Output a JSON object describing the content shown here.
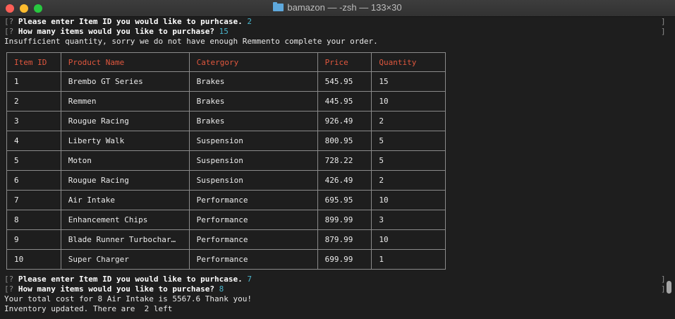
{
  "window": {
    "title": "bamazon — -zsh — 133×30"
  },
  "prompts_top": {
    "q1_mark": "[?",
    "q1_text": " Please enter Item ID you would like to purhcase.",
    "q1_answer": " 2",
    "q2_mark": "[?",
    "q2_text": " How many items would you like to purchase?",
    "q2_answer": " 15",
    "message": "Insufficient quantity, sorry we do not have enough Remmento complete your order."
  },
  "table": {
    "headers": [
      "Item ID",
      "Product Name",
      "Catergory",
      "Price",
      "Quantity"
    ],
    "rows": [
      [
        "1",
        "Brembo GT Series",
        "Brakes",
        "545.95",
        "15"
      ],
      [
        "2",
        "Remmen",
        "Brakes",
        "445.95",
        "10"
      ],
      [
        "3",
        "Rougue Racing",
        "Brakes",
        "926.49",
        "2"
      ],
      [
        "4",
        "Liberty Walk",
        "Suspension",
        "800.95",
        "5"
      ],
      [
        "5",
        "Moton",
        "Suspension",
        "728.22",
        "5"
      ],
      [
        "6",
        "Rougue Racing",
        "Suspension",
        "426.49",
        "2"
      ],
      [
        "7",
        "Air Intake",
        "Performance",
        "695.95",
        "10"
      ],
      [
        "8",
        "Enhancement Chips",
        "Performance",
        "899.99",
        "3"
      ],
      [
        "9",
        "Blade Runner Turbochar…",
        "Performance",
        "879.99",
        "10"
      ],
      [
        "10",
        "Super Charger",
        "Performance",
        "699.99",
        "1"
      ]
    ]
  },
  "prompts_bottom": {
    "q1_mark": "[?",
    "q1_text": " Please enter Item ID you would like to purhcase.",
    "q1_answer": " 7",
    "q2_mark": "[?",
    "q2_text": " How many items would you like to purchase?",
    "q2_answer": " 8",
    "total": "Your total cost for 8 Air Intake is 5567.6 Thank you!",
    "inventory": "Inventory updated. There are  2 left"
  },
  "markers": {
    "bracket": "]"
  },
  "colors": {
    "answer": "#4ab5cc",
    "header": "#e0573e",
    "background": "#1e1e1e"
  }
}
